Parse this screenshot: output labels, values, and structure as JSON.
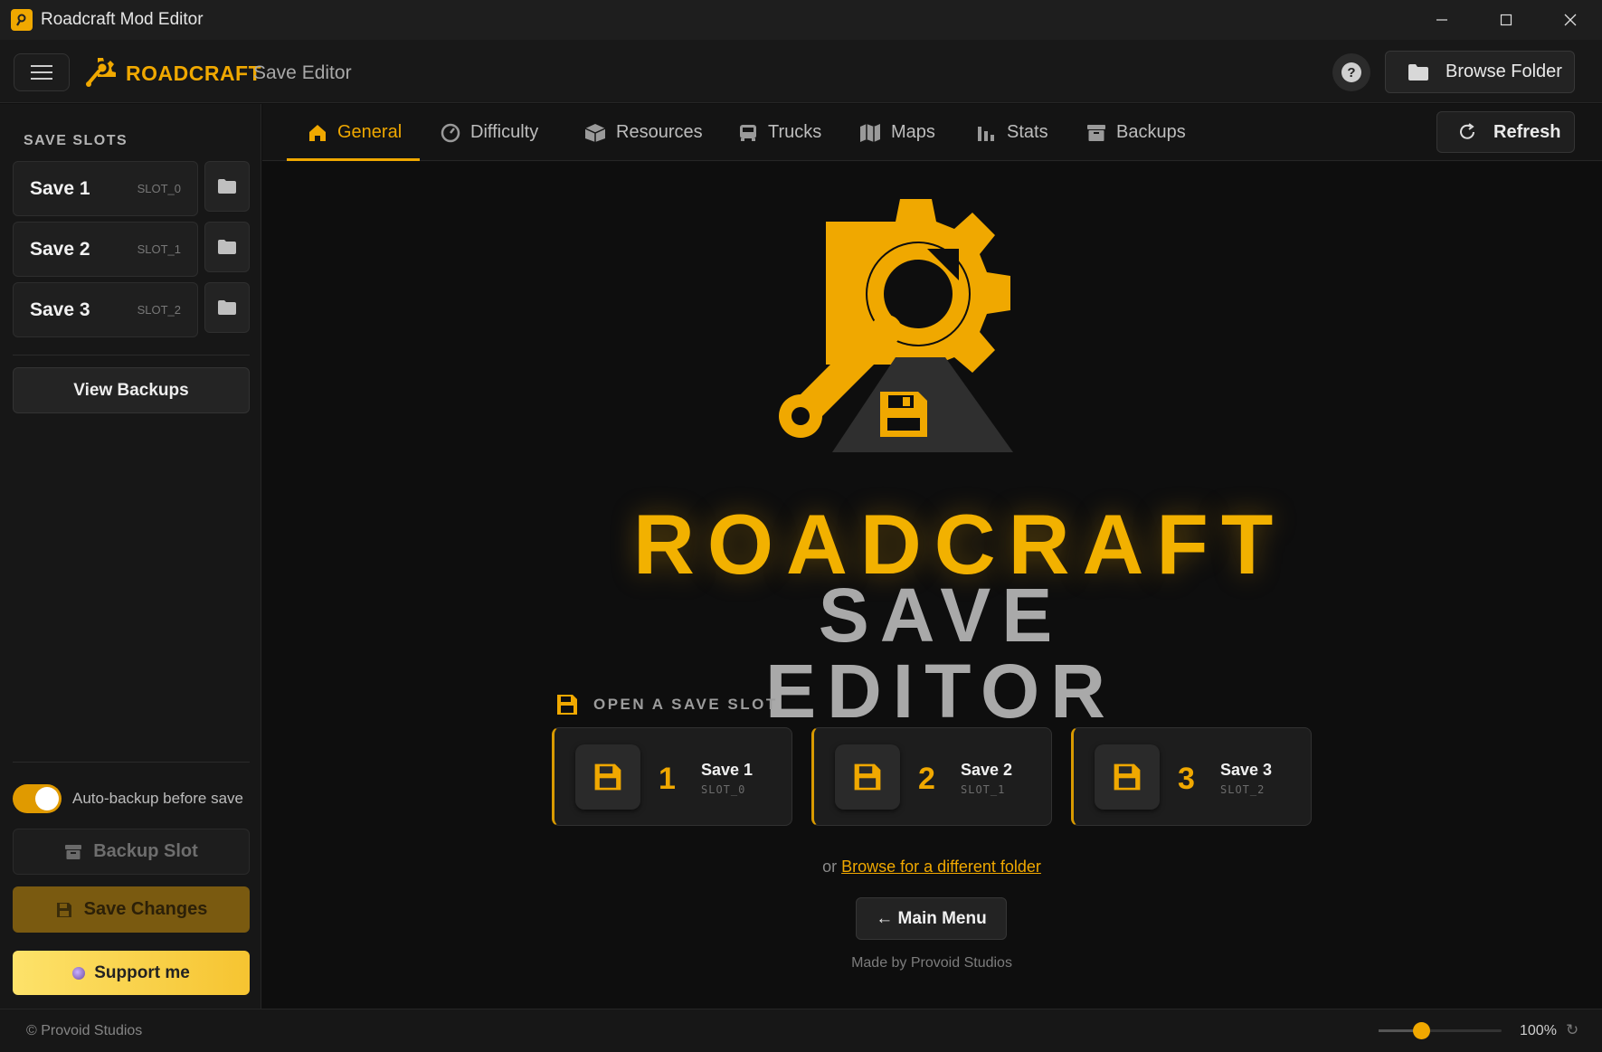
{
  "window": {
    "title": "Roadcraft Mod Editor",
    "controls": [
      "minimize",
      "maximize",
      "close"
    ]
  },
  "header": {
    "brand_name": "ROADCRAFT",
    "brand_sub": "Save Editor",
    "help_label": "?",
    "browse_label": "Browse Folder"
  },
  "sidebar": {
    "heading": "SAVE SLOTS",
    "slots": [
      {
        "name": "Save 1",
        "id": "SLOT_0"
      },
      {
        "name": "Save 2",
        "id": "SLOT_1"
      },
      {
        "name": "Save 3",
        "id": "SLOT_2"
      }
    ],
    "view_backups_label": "View Backups",
    "auto_backup_label": "Auto-backup before save",
    "auto_backup_enabled": true,
    "backup_slot_label": "Backup Slot",
    "save_changes_label": "Save Changes",
    "support_label": "Support me"
  },
  "tabs": [
    {
      "label": "General",
      "icon": "home-icon",
      "active": true
    },
    {
      "label": "Difficulty",
      "icon": "gauge-icon",
      "active": false
    },
    {
      "label": "Resources",
      "icon": "box-icon",
      "active": false
    },
    {
      "label": "Trucks",
      "icon": "truck-icon",
      "active": false
    },
    {
      "label": "Maps",
      "icon": "map-icon",
      "active": false
    },
    {
      "label": "Stats",
      "icon": "chart-icon",
      "active": false
    },
    {
      "label": "Backups",
      "icon": "archive-icon",
      "active": false
    }
  ],
  "refresh_label": "Refresh",
  "main": {
    "hero_line1": "ROADCRAFT",
    "hero_line2": "SAVE EDITOR",
    "open_heading": "OPEN A SAVE SLOT",
    "cards": [
      {
        "num": "1",
        "name": "Save 1",
        "id": "SLOT_0"
      },
      {
        "num": "2",
        "name": "Save 2",
        "id": "SLOT_1"
      },
      {
        "num": "3",
        "name": "Save 3",
        "id": "SLOT_2"
      }
    ],
    "or_text": "or",
    "browse_link": "Browse for a different folder",
    "main_menu_label": "← Main Menu",
    "made_by": "Made by Provoid Studios"
  },
  "status": {
    "copyright": "© Provoid Studios",
    "zoom_label": "100%",
    "zoom_level": 0.35
  },
  "colors": {
    "accent": "#f0a800",
    "background": "#0e0e0e",
    "panel": "#171717"
  }
}
